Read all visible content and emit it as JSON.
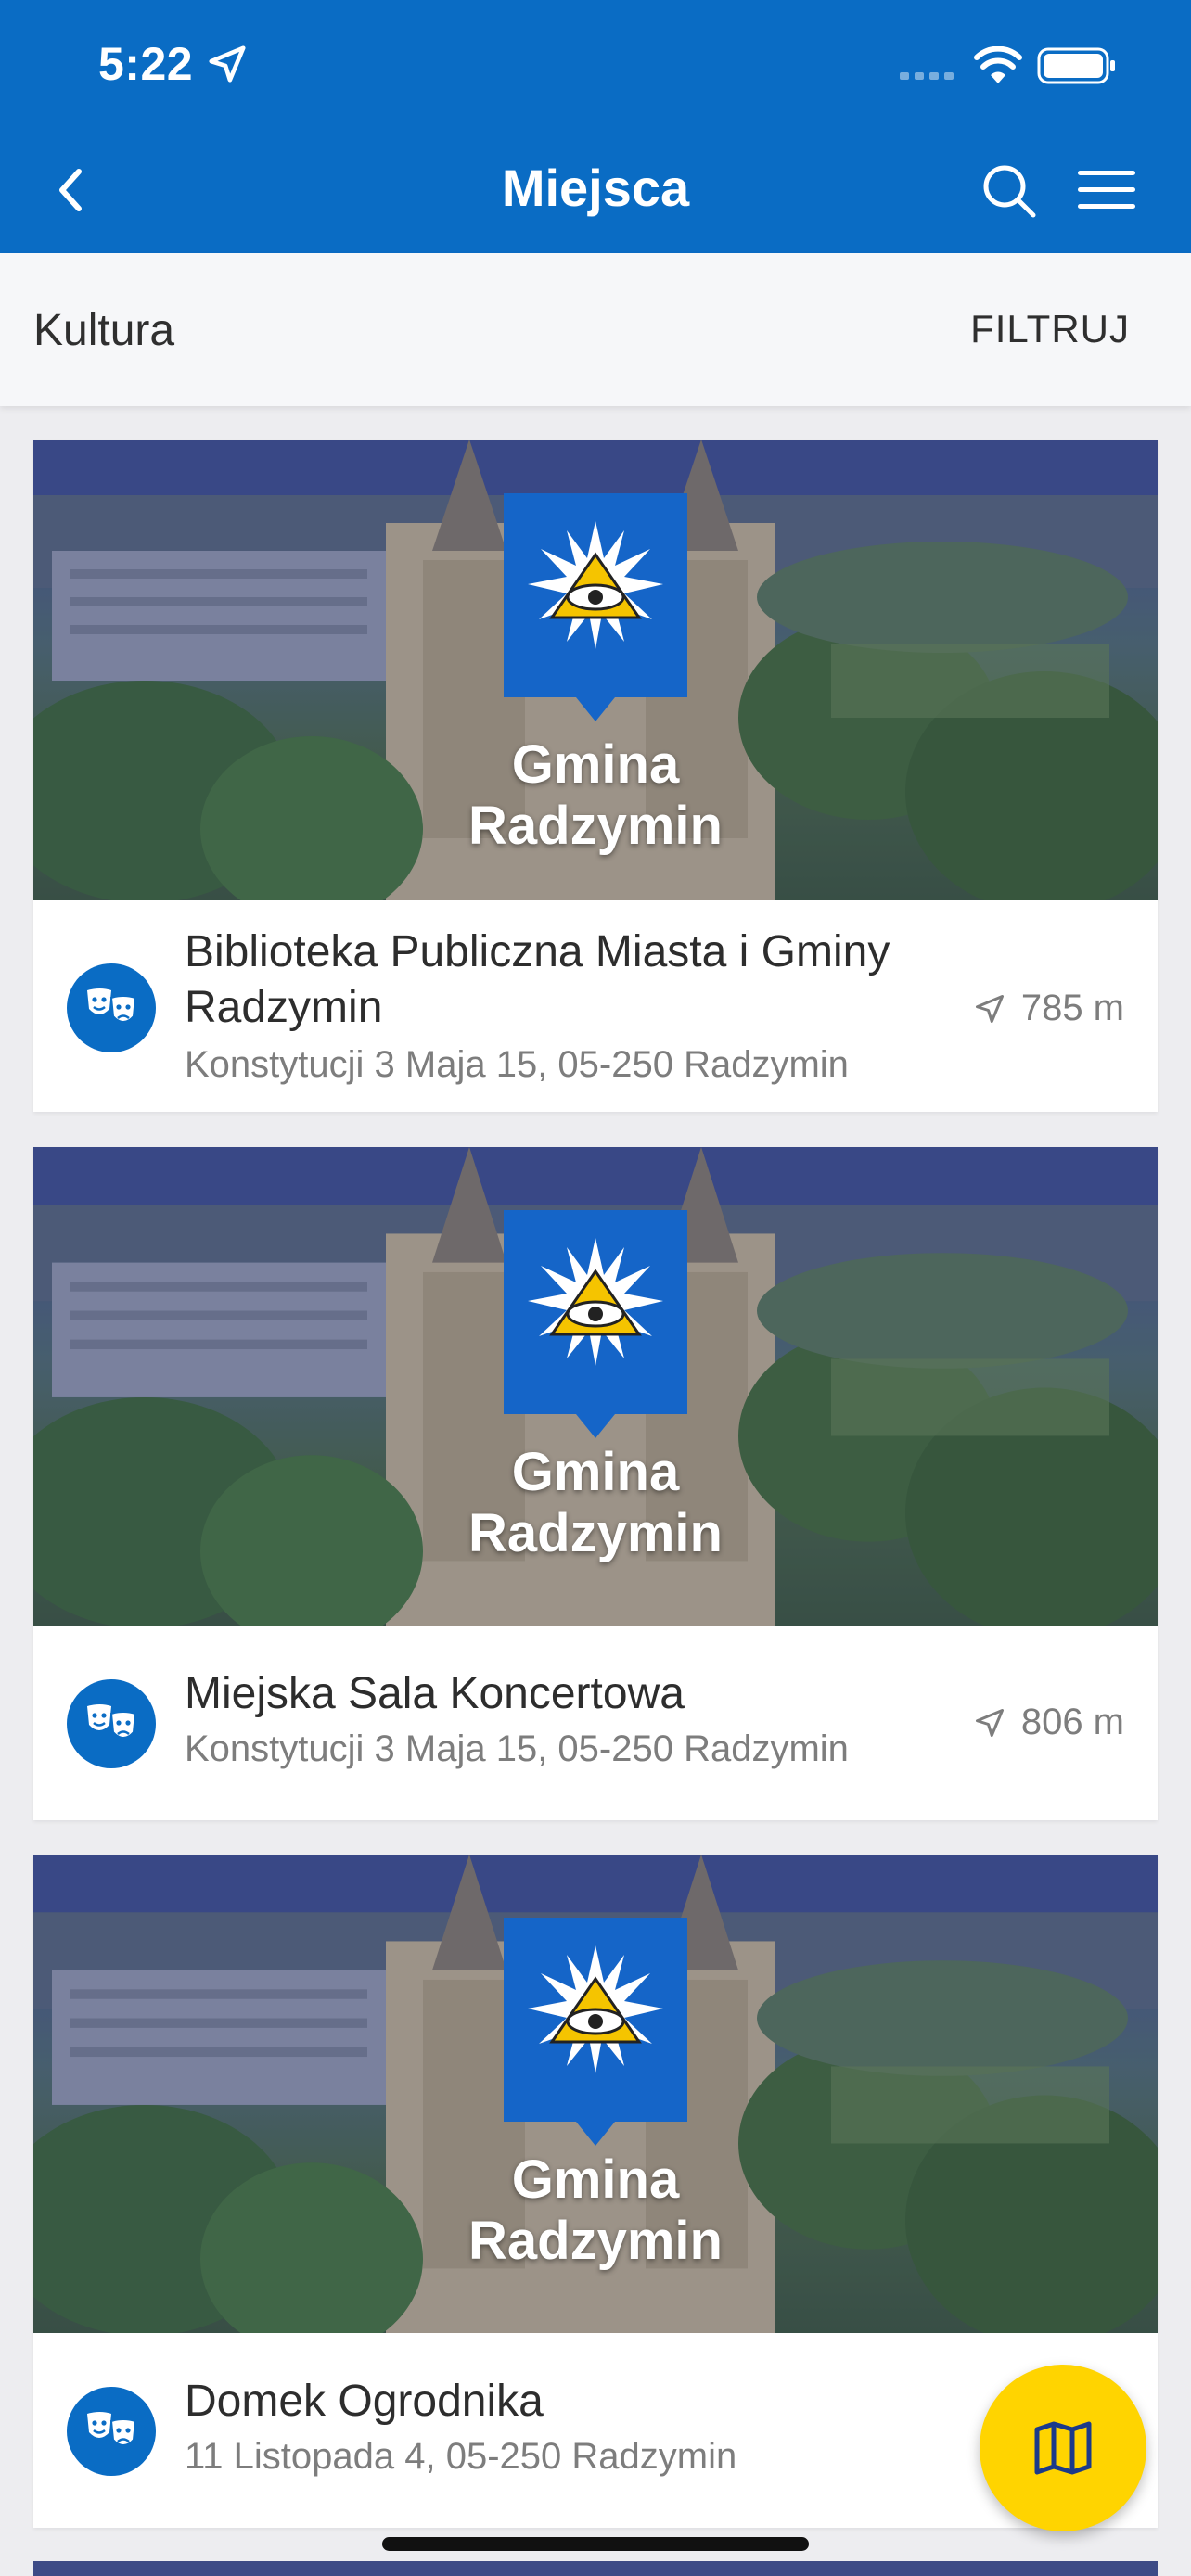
{
  "status_bar": {
    "time": "5:22"
  },
  "header": {
    "title": "Miejsca"
  },
  "filter": {
    "category": "Kultura",
    "button_label": "FILTRUJ"
  },
  "places": [
    {
      "image_brand_line1": "Gmina",
      "image_brand_line2": "Radzymin",
      "name": "Biblioteka Publiczna Miasta i Gminy Radzymin",
      "address": "Konstytucji 3 Maja 15, 05-250  Radzymin",
      "distance": "785 m",
      "category_icon": "theater-masks-icon"
    },
    {
      "image_brand_line1": "Gmina",
      "image_brand_line2": "Radzymin",
      "name": "Miejska Sala Koncertowa",
      "address": "Konstytucji 3 Maja 15, 05-250  Radzymin",
      "distance": "806 m",
      "category_icon": "theater-masks-icon"
    },
    {
      "image_brand_line1": "Gmina",
      "image_brand_line2": "Radzymin",
      "name": "Domek Ogrodnika",
      "address": "11 Listopada 4, 05-250  Radzymin",
      "distance": "",
      "category_icon": "theater-masks-icon"
    }
  ],
  "colors": {
    "primary": "#0a6cc4",
    "fab": "#ffd400",
    "crest_blue": "#1565c8",
    "crest_yellow": "#f5c400"
  }
}
